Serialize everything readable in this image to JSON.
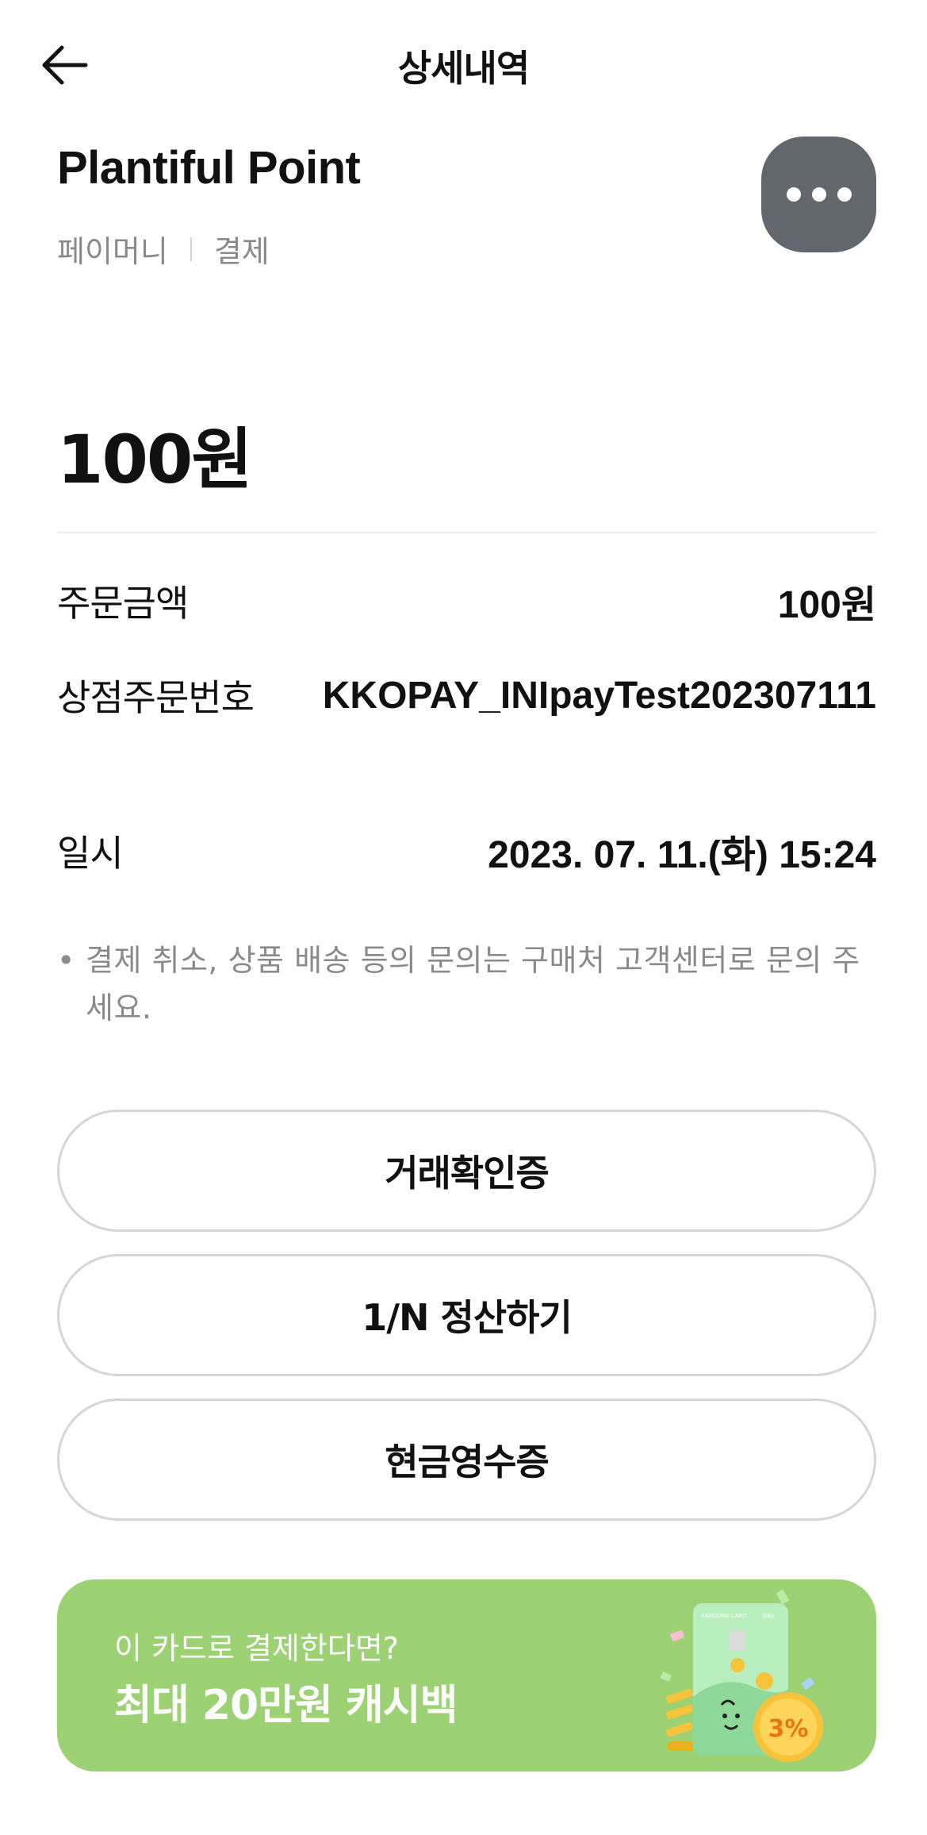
{
  "header": {
    "title": "상세내역"
  },
  "merchant": {
    "name": "Plantiful Point",
    "method": "페이머니",
    "type": "결제"
  },
  "amount": "100원",
  "details": [
    {
      "label": "주문금액",
      "value": "100원"
    },
    {
      "label": "상점주문번호",
      "value": "KKOPAY_INIpayTest202307111"
    },
    {
      "label": "일시",
      "value": "2023. 07. 11.(화) 15:24"
    }
  ],
  "notice": {
    "bullet": "•",
    "text": "결제 취소, 상품 배송 등의 문의는 구매처 고객센터로 문의 주세요."
  },
  "actions": {
    "transaction_cert": "거래확인증",
    "split_bill": "1/N 정산하기",
    "cash_receipt": "현금영수증"
  },
  "banner": {
    "subtitle": "이 카드로 결제한다면?",
    "headline": "최대 20만원 캐시백",
    "card_brand": "SAMSUNG CARD",
    "card_pay": "pay",
    "badge": "3%"
  },
  "colors": {
    "banner_bg": "#9cd174",
    "more_button_bg": "#62666d",
    "badge_gold": "#f6c33a",
    "badge_text": "#e8760f"
  },
  "icons": {
    "back": "arrow-left-icon",
    "more": "more-dots-icon"
  }
}
